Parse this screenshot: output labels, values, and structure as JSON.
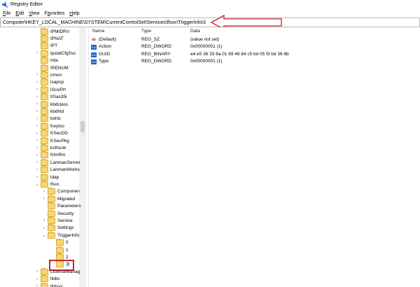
{
  "window": {
    "title": "Registry Editor"
  },
  "menu": [
    {
      "label": "File",
      "key": "F"
    },
    {
      "label": "Edit",
      "key": "E"
    },
    {
      "label": "View",
      "key": "V"
    },
    {
      "label": "Favorites",
      "key": "a"
    },
    {
      "label": "Help",
      "key": "H"
    }
  ],
  "address": {
    "path": "Computer\\HKEY_LOCAL_MACHINE\\SYSTEM\\CurrentControlSet\\Services\\lfsvc\\TriggerInfo\\3"
  },
  "tree": [
    {
      "label": "IPMIDRV",
      "level": 1,
      "expand": ""
    },
    {
      "label": "IPNAT",
      "level": 1,
      "expand": ""
    },
    {
      "label": "IPT",
      "level": 1,
      "expand": ""
    },
    {
      "label": "IpxlatCfgSvc",
      "level": 1,
      "expand": ">"
    },
    {
      "label": "irda",
      "level": 1,
      "expand": ""
    },
    {
      "label": "IRENUM",
      "level": 1,
      "expand": ""
    },
    {
      "label": "irmon",
      "level": 1,
      "expand": ">"
    },
    {
      "label": "isapnp",
      "level": 1,
      "expand": ">"
    },
    {
      "label": "iScsiPrt",
      "level": 1,
      "expand": ">"
    },
    {
      "label": "ItSas35i",
      "level": 1,
      "expand": ">"
    },
    {
      "label": "kbdclass",
      "level": 1,
      "expand": ">"
    },
    {
      "label": "kbdhid",
      "level": 1,
      "expand": ">"
    },
    {
      "label": "kdnic",
      "level": 1,
      "expand": ">"
    },
    {
      "label": "KeyIso",
      "level": 1,
      "expand": ">"
    },
    {
      "label": "KSecDD",
      "level": 1,
      "expand": ">"
    },
    {
      "label": "KSecPkg",
      "level": 1,
      "expand": ">"
    },
    {
      "label": "ksthunk",
      "level": 1,
      "expand": ">"
    },
    {
      "label": "KtmRm",
      "level": 1,
      "expand": ">"
    },
    {
      "label": "LanmanServer",
      "level": 1,
      "expand": ">"
    },
    {
      "label": "LanmanWorks",
      "level": 1,
      "expand": ">"
    },
    {
      "label": "ldap",
      "level": 1,
      "expand": ">"
    },
    {
      "label": "lfsvc",
      "level": 1,
      "expand": "v"
    },
    {
      "label": "Componen",
      "level": 2,
      "expand": ">"
    },
    {
      "label": "Migrated",
      "level": 2,
      "expand": ">"
    },
    {
      "label": "Parameters",
      "level": 2,
      "expand": ""
    },
    {
      "label": "Security",
      "level": 2,
      "expand": ""
    },
    {
      "label": "Service",
      "level": 2,
      "expand": ">"
    },
    {
      "label": "Settings",
      "level": 2,
      "expand": ">"
    },
    {
      "label": "TriggerInfo",
      "level": 2,
      "expand": "v"
    },
    {
      "label": "0",
      "level": 3,
      "expand": ""
    },
    {
      "label": "1",
      "level": 3,
      "expand": ""
    },
    {
      "label": "2",
      "level": 3,
      "expand": ""
    },
    {
      "label": "3",
      "level": 3,
      "expand": "",
      "selected": true
    },
    {
      "label": "LicenseManag",
      "level": 1,
      "expand": ">"
    },
    {
      "label": "lltdio",
      "level": 1,
      "expand": ">"
    },
    {
      "label": "lltdsvc",
      "level": 1,
      "expand": ">"
    }
  ],
  "list": {
    "columns": [
      "Name",
      "Type",
      "Data"
    ],
    "rows": [
      {
        "icon": "string-value-icon",
        "name": "(Default)",
        "type": "REG_SZ",
        "data": "(value not set)"
      },
      {
        "icon": "binary-value-icon",
        "name": "Action",
        "type": "REG_DWORD",
        "data": "0x00000001 (1)"
      },
      {
        "icon": "binary-value-icon",
        "name": "GUID",
        "type": "REG_BINARY",
        "data": "e4 e5 36 33 8a 01 69 46 84 c5 bd 05 f3 bd 36 8b"
      },
      {
        "icon": "binary-value-icon",
        "name": "Type",
        "type": "REG_DWORD",
        "data": "0x00000001 (1)"
      }
    ]
  },
  "annotations": {
    "color": "#c8242b"
  }
}
